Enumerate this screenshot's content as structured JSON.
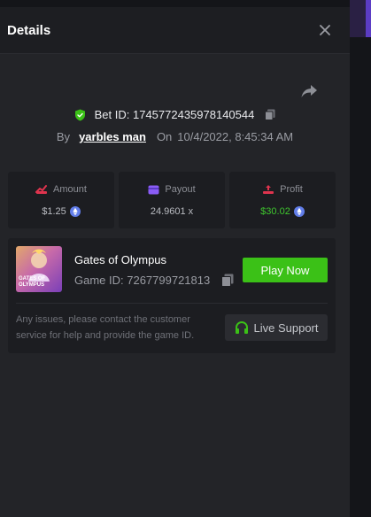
{
  "header": {
    "title": "Details"
  },
  "bet": {
    "prefix": "Bet ID: ",
    "id": "1745772435978140544"
  },
  "meta": {
    "by_label": "By",
    "username": "yarbles man",
    "on_label": "On",
    "datetime": "10/4/2022, 8:45:34 AM"
  },
  "stats": {
    "amount": {
      "label": "Amount",
      "value": "$1.25",
      "icon": "eth-coin-icon"
    },
    "payout": {
      "label": "Payout",
      "value": "24.9601 x"
    },
    "profit": {
      "label": "Profit",
      "value": "$30.02",
      "icon": "eth-coin-icon"
    }
  },
  "game": {
    "title": "Gates of Olympus",
    "id_label": "Game ID: 7267799721813",
    "thumb_text_line1": "GATES OF",
    "thumb_text_line2": "OLYMPUS",
    "play_label": "Play Now",
    "support_note": "Any issues, please contact the customer service for help and provide the game ID.",
    "live_label": "Live Support"
  },
  "colors": {
    "accent_green": "#3bc117",
    "profit_green": "#3ec52e",
    "eth_blue": "#627eea",
    "purple": "#8a5cf6",
    "red": "#e0344e"
  }
}
